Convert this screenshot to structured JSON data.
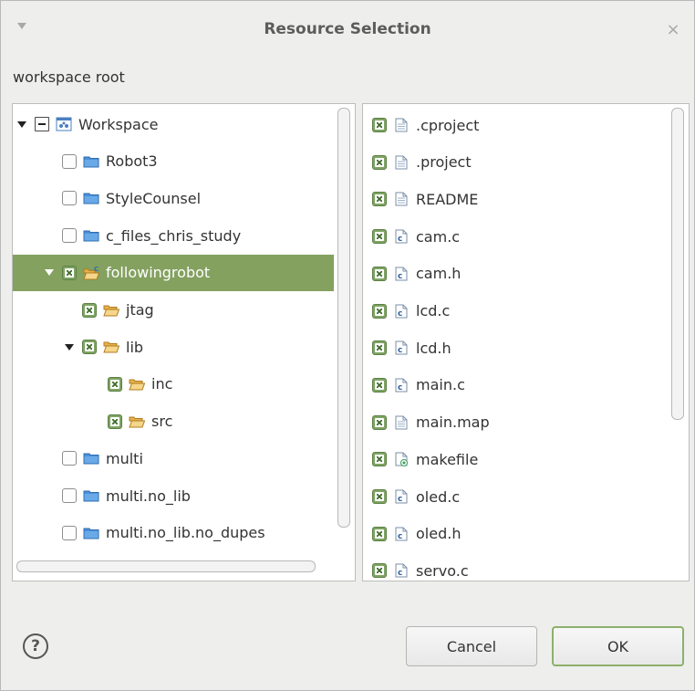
{
  "window": {
    "title": "Resource Selection",
    "close_glyph": "×",
    "menu_icon": "triangle-down-icon"
  },
  "section_label": "workspace root",
  "tree": [
    {
      "label": "Workspace",
      "depth": 0,
      "arrow": "down",
      "check": "partial",
      "icon": "workspace-icon",
      "selected": false
    },
    {
      "label": "Robot3",
      "depth": 1,
      "arrow": "none",
      "check": "unchecked",
      "icon": "project-closed-icon",
      "selected": false
    },
    {
      "label": "StyleCounsel",
      "depth": 1,
      "arrow": "none",
      "check": "unchecked",
      "icon": "project-closed-icon",
      "selected": false
    },
    {
      "label": "c_files_chris_study",
      "depth": 1,
      "arrow": "none",
      "check": "unchecked",
      "icon": "project-closed-icon",
      "selected": false
    },
    {
      "label": "followingrobot",
      "depth": 1,
      "arrow": "down",
      "check": "checked",
      "icon": "c-project-open-icon",
      "selected": true
    },
    {
      "label": "jtag",
      "depth": 2,
      "arrow": "none",
      "check": "checked",
      "icon": "folder-open-icon",
      "selected": false
    },
    {
      "label": "lib",
      "depth": 2,
      "arrow": "down",
      "check": "checked",
      "icon": "folder-open-icon",
      "selected": false
    },
    {
      "label": "inc",
      "depth": 3,
      "arrow": "none",
      "check": "checked",
      "icon": "folder-open-icon",
      "selected": false
    },
    {
      "label": "src",
      "depth": 3,
      "arrow": "none",
      "check": "checked",
      "icon": "folder-open-icon",
      "selected": false
    },
    {
      "label": "multi",
      "depth": 1,
      "arrow": "none",
      "check": "unchecked",
      "icon": "project-closed-icon",
      "selected": false
    },
    {
      "label": "multi.no_lib",
      "depth": 1,
      "arrow": "none",
      "check": "unchecked",
      "icon": "project-closed-icon",
      "selected": false
    },
    {
      "label": "multi.no_lib.no_dupes",
      "depth": 1,
      "arrow": "none",
      "check": "unchecked",
      "icon": "project-closed-icon",
      "selected": false
    }
  ],
  "files": [
    {
      "label": ".cproject",
      "check": "checked",
      "icon": "text-file-icon"
    },
    {
      "label": ".project",
      "check": "checked",
      "icon": "text-file-icon"
    },
    {
      "label": "README",
      "check": "checked",
      "icon": "text-file-icon"
    },
    {
      "label": "cam.c",
      "check": "checked",
      "icon": "c-source-file-icon"
    },
    {
      "label": "cam.h",
      "check": "checked",
      "icon": "c-source-file-icon"
    },
    {
      "label": "lcd.c",
      "check": "checked",
      "icon": "c-source-file-icon"
    },
    {
      "label": "lcd.h",
      "check": "checked",
      "icon": "c-source-file-icon"
    },
    {
      "label": "main.c",
      "check": "checked",
      "icon": "c-source-file-icon"
    },
    {
      "label": "main.map",
      "check": "checked",
      "icon": "text-file-icon"
    },
    {
      "label": "makefile",
      "check": "checked",
      "icon": "makefile-icon"
    },
    {
      "label": "oled.c",
      "check": "checked",
      "icon": "c-source-file-icon"
    },
    {
      "label": "oled.h",
      "check": "checked",
      "icon": "c-source-file-icon"
    },
    {
      "label": "servo.c",
      "check": "checked",
      "icon": "c-source-file-icon"
    }
  ],
  "footer": {
    "help_glyph": "?",
    "cancel_label": "Cancel",
    "ok_label": "OK"
  },
  "colors": {
    "selection": "#84a160",
    "checkbox_checked": "#7fa463",
    "folder_closed": "#4a90d9",
    "folder_open": "#e6b04a"
  }
}
